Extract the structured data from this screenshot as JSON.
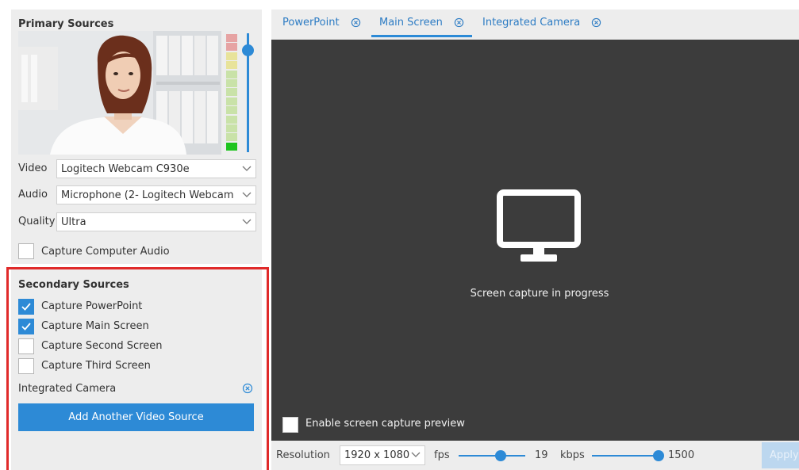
{
  "primary": {
    "title": "Primary Sources",
    "video_label": "Video",
    "video_value": "Logitech Webcam C930e",
    "audio_label": "Audio",
    "audio_value": "Microphone (2- Logitech Webcam",
    "quality_label": "Quality",
    "quality_value": "Ultra",
    "capture_audio_label": "Capture Computer Audio",
    "capture_audio_checked": false,
    "volume_level": 0.86
  },
  "secondary": {
    "title": "Secondary Sources",
    "items": [
      {
        "label": "Capture PowerPoint",
        "checked": true
      },
      {
        "label": "Capture Main Screen",
        "checked": true
      },
      {
        "label": "Capture Second Screen",
        "checked": false
      },
      {
        "label": "Capture Third Screen",
        "checked": false
      }
    ],
    "camera_label": "Integrated Camera",
    "add_button": "Add Another Video Source"
  },
  "tabs": [
    {
      "label": "PowerPoint",
      "active": false
    },
    {
      "label": "Main Screen",
      "active": true
    },
    {
      "label": "Integrated Camera",
      "active": false
    }
  ],
  "preview": {
    "status": "Screen capture in progress",
    "enable_preview_label": "Enable screen capture preview"
  },
  "bottom": {
    "resolution_label": "Resolution",
    "resolution_value": "1920 x 1080",
    "fps_label": "fps",
    "fps_value": "19",
    "kbps_label": "kbps",
    "kbps_value": "1500",
    "apply_label": "Apply"
  },
  "icons": {
    "tab_close": "close-circle-icon",
    "monitor": "monitor-icon",
    "chevron": "chevron-down-icon",
    "check": "check-icon"
  },
  "colors": {
    "accent": "#2d8ad6",
    "highlight": "#e02a2a",
    "preview_bg": "#3c3c3c"
  }
}
